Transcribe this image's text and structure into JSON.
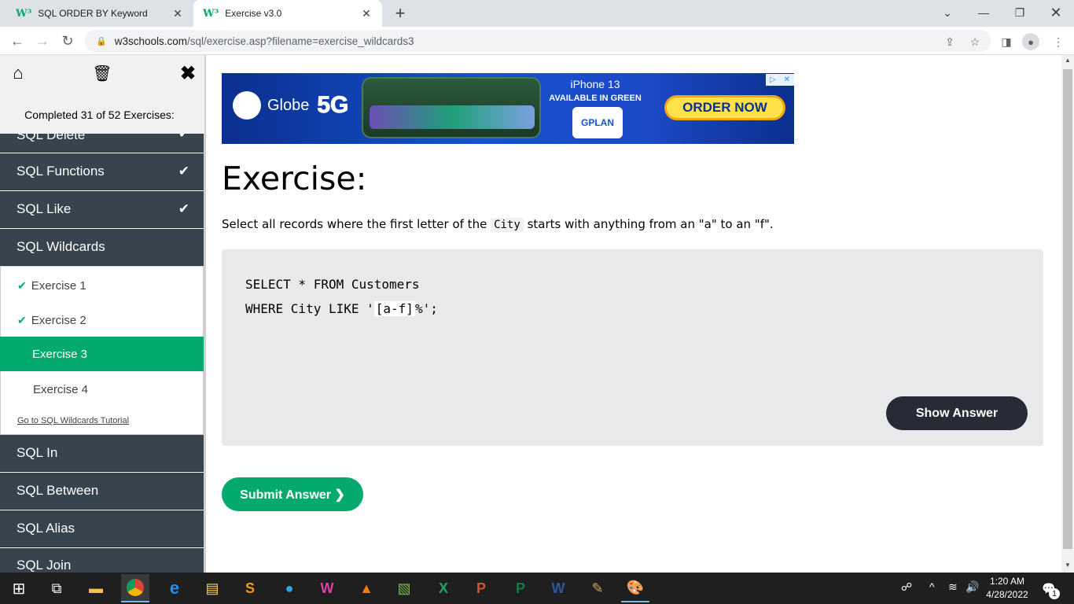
{
  "browser": {
    "tabs": [
      {
        "label": "SQL ORDER BY Keyword",
        "active": false
      },
      {
        "label": "Exercise v3.0",
        "active": true
      }
    ],
    "tab_logo": "W³",
    "new_tab": "+",
    "url_host": "w3schools.com",
    "url_path": "/sql/exercise.asp?filename=exercise_wildcards3"
  },
  "sidebar": {
    "completed_text": "Completed 31 of 52 Exercises:",
    "top_items": [
      {
        "label": "SQL Delete",
        "done": true
      },
      {
        "label": "SQL Functions",
        "done": true
      },
      {
        "label": "SQL Like",
        "done": true
      },
      {
        "label": "SQL Wildcards",
        "done": false
      }
    ],
    "exercises": [
      {
        "label": "Exercise 1",
        "done": true
      },
      {
        "label": "Exercise 2",
        "done": true
      },
      {
        "label": "Exercise 3",
        "active": true
      },
      {
        "label": "Exercise 4",
        "done": false
      }
    ],
    "tutorial_link": "Go to SQL Wildcards Tutorial",
    "bottom_items": [
      "SQL In",
      "SQL Between",
      "SQL Alias",
      "SQL Join"
    ],
    "check_glyph": "✔"
  },
  "ad": {
    "brand": "Globe",
    "brand_5g": "5G",
    "product": "iPhone 13",
    "subtitle": "AVAILABLE IN GREEN",
    "plan": "GPLAN",
    "cta": "ORDER NOW"
  },
  "exercise": {
    "heading": "Exercise:",
    "instruction_before": "Select all records where the first letter of the ",
    "instruction_code": "City",
    "instruction_after": " starts with anything from an \"a\" to an \"f\".",
    "code_line1": "SELECT * FROM Customers",
    "code_line2_prefix": "WHERE City LIKE '",
    "code_answer": "[a-f]",
    "code_line2_suffix": "%';",
    "show_answer": "Show Answer",
    "submit": "Submit Answer ❯"
  },
  "taskbar": {
    "time": "1:20 AM",
    "date": "4/28/2022",
    "notifications": "1"
  }
}
